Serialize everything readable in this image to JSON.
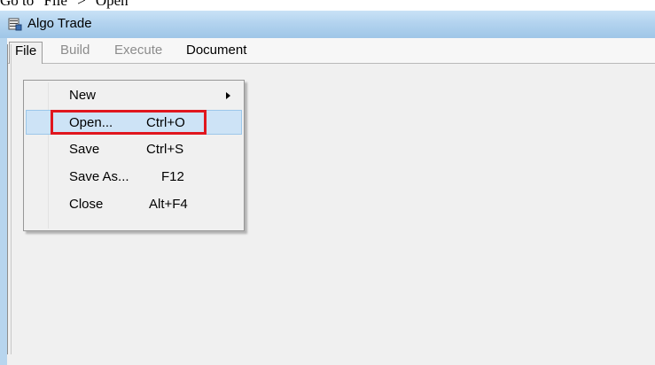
{
  "caption": "Go to \"File\" > \"Open\"",
  "window": {
    "title": "Algo Trade",
    "icon": "app-window-icon"
  },
  "menubar": {
    "items": [
      {
        "label": "File",
        "enabled": true,
        "open": true
      },
      {
        "label": "Build",
        "enabled": false
      },
      {
        "label": "Execute",
        "enabled": false
      },
      {
        "label": "Document",
        "enabled": true
      }
    ]
  },
  "file_menu": {
    "items": [
      {
        "label": "New",
        "shortcut": "",
        "submenu": true
      },
      {
        "label": "Open...",
        "shortcut": "Ctrl+O",
        "highlighted": true
      },
      {
        "label": "Save",
        "shortcut": "Ctrl+S"
      },
      {
        "label": "Save As...",
        "shortcut": "F12"
      },
      {
        "label": "Close",
        "shortcut": "Alt+F4"
      }
    ]
  },
  "colors": {
    "highlight_box": "#e0161e",
    "selection_bg": "#cde3f6",
    "titlebar": "#b3d3ef"
  }
}
